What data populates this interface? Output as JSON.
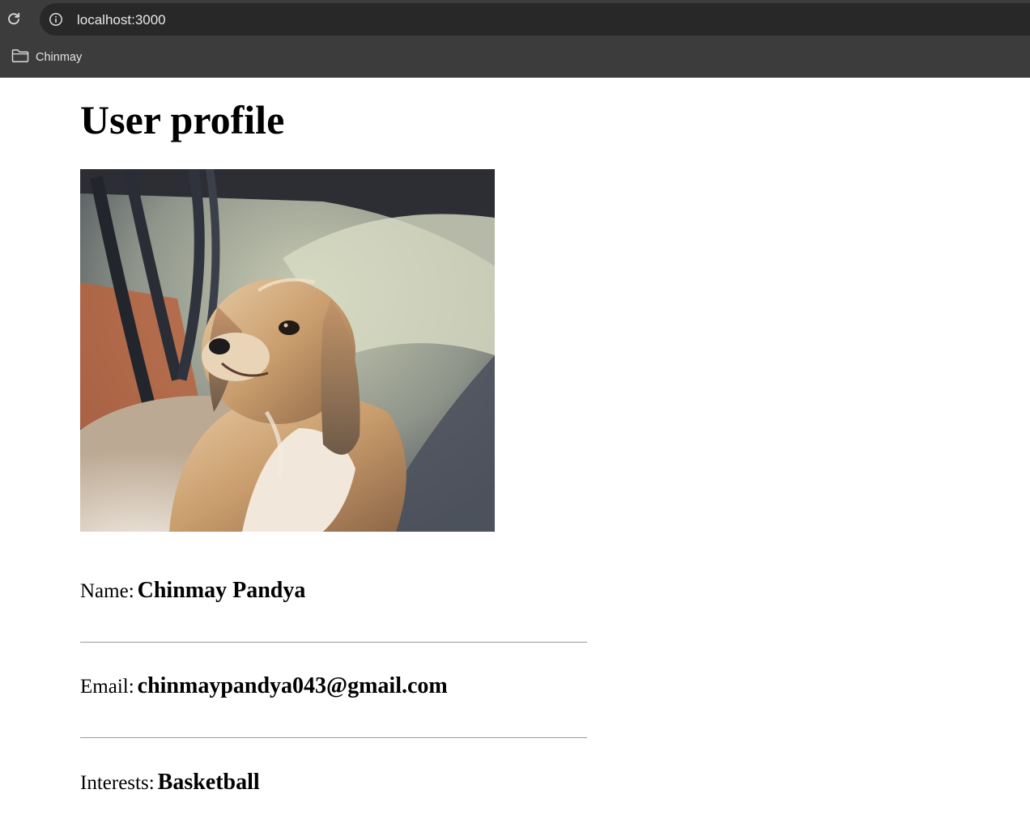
{
  "browser": {
    "url": "localhost:3000",
    "bookmarks": [
      {
        "label": "Chinmay"
      }
    ]
  },
  "profile": {
    "title": "User profile",
    "fields": {
      "name": {
        "label": "Name:",
        "value": "Chinmay Pandya"
      },
      "email": {
        "label": "Email:",
        "value": "chinmaypandya043@gmail.com"
      },
      "interests": {
        "label": "Interests:",
        "value": "Basketball"
      }
    }
  },
  "icons": {
    "reload": "reload-icon",
    "site_info": "info-icon",
    "bookmark_folder": "folder-icon"
  },
  "colors": {
    "chrome_background": "#3c3c3c",
    "omnibox_background": "#282828",
    "page_background": "#ffffff",
    "text": "#000000"
  }
}
